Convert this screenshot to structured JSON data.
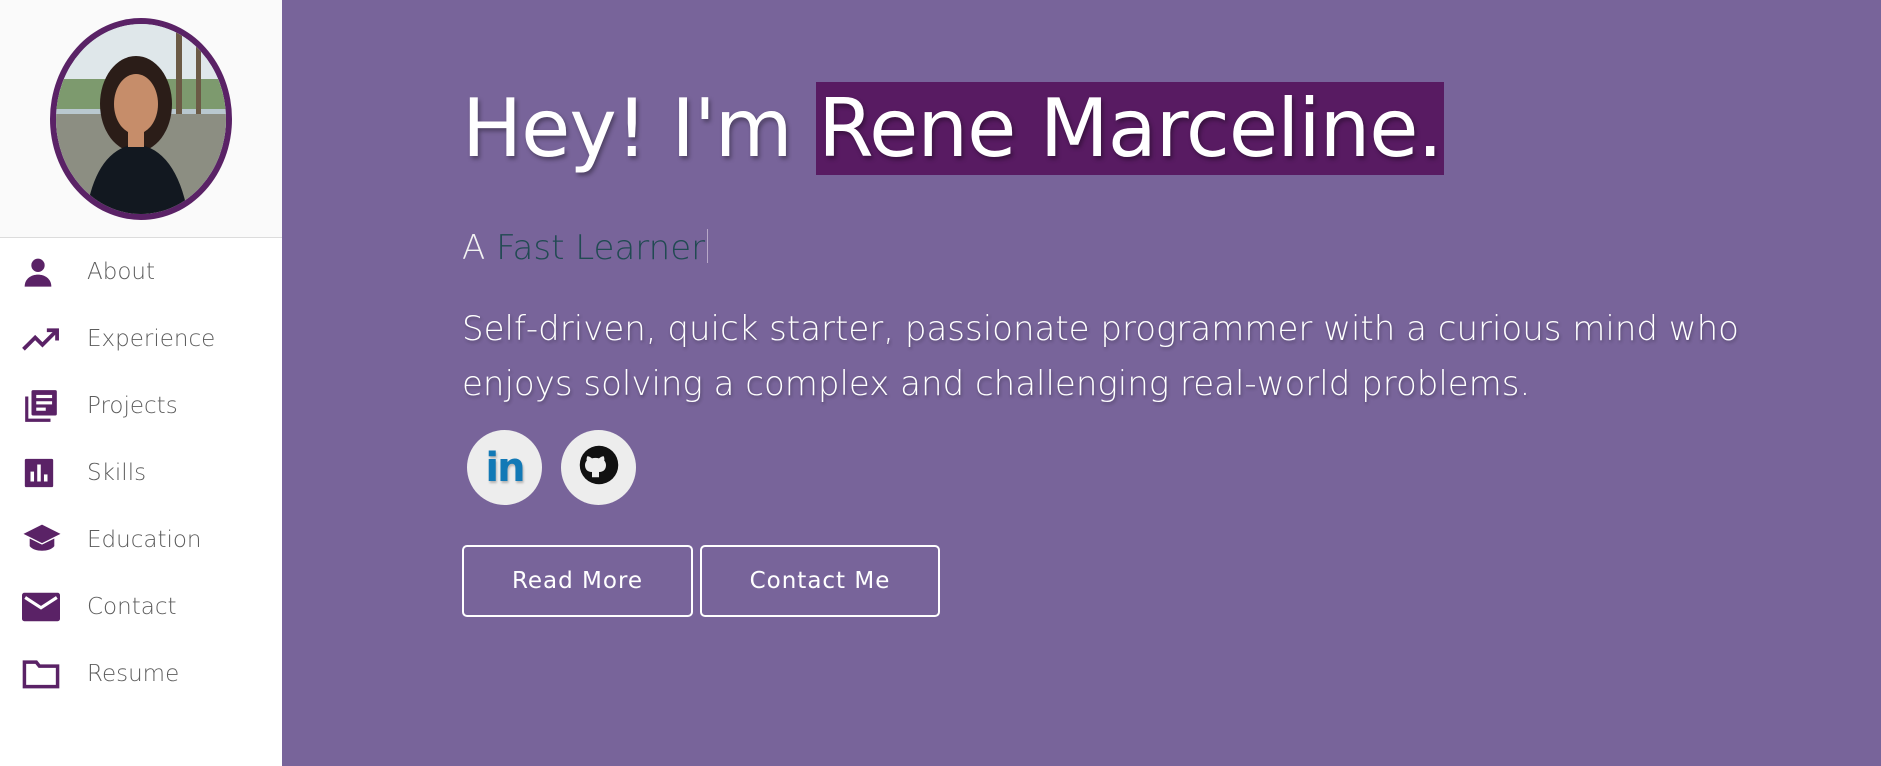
{
  "sidebar": {
    "avatar_alt": "Profile photo",
    "items": [
      {
        "label": "About",
        "icon": "person-icon"
      },
      {
        "label": "Experience",
        "icon": "trending-up-icon"
      },
      {
        "label": "Projects",
        "icon": "library-books-icon"
      },
      {
        "label": "Skills",
        "icon": "bar-chart-icon"
      },
      {
        "label": "Education",
        "icon": "graduation-cap-icon"
      },
      {
        "label": "Contact",
        "icon": "mail-icon"
      },
      {
        "label": "Resume",
        "icon": "folder-icon"
      }
    ]
  },
  "hero": {
    "greeting": "Hey! I'm ",
    "name": "Rene Marceline.",
    "tagline_prefix": "A ",
    "tagline_accent": "Fast Learner",
    "bio": "Self-driven, quick starter, passionate programmer with a curious mind who enjoys solving a complex and challenging real-world problems."
  },
  "socials": [
    {
      "name": "LinkedIn",
      "icon": "linkedin-icon",
      "text": "in"
    },
    {
      "name": "GitHub",
      "icon": "github-icon"
    }
  ],
  "buttons": {
    "read_more": "Read More",
    "contact_me": "Contact Me"
  },
  "colors": {
    "background": "#78649a",
    "accent": "#5a2266",
    "name_highlight": "#581b62",
    "tagline_accent": "#214a52"
  }
}
